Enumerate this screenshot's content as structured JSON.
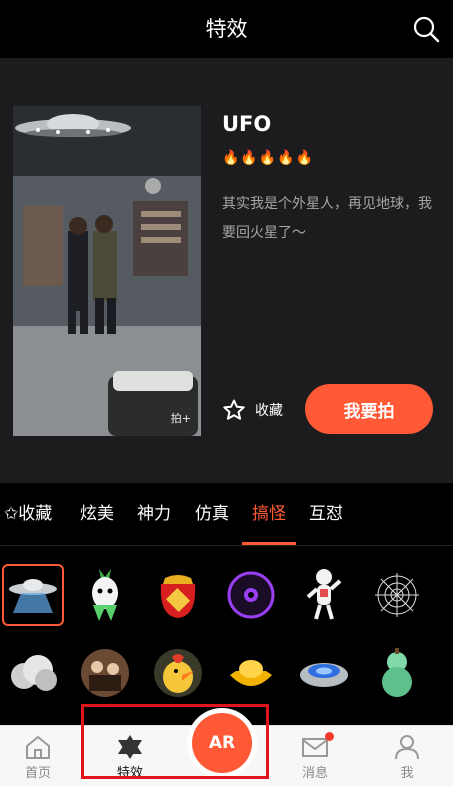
{
  "header": {
    "title": "特效",
    "search_icon": "search-icon"
  },
  "effect": {
    "name": "UFO",
    "rating_fires": "🔥🔥🔥🔥🔥",
    "description": "其实我是个外星人，再见地球，我要回火星了～",
    "favorite_label": "收藏",
    "shoot_label": "我要拍",
    "watermark": "拍+"
  },
  "tabs": [
    {
      "label": "✩收藏",
      "active": false
    },
    {
      "label": "炫美",
      "active": false
    },
    {
      "label": "神力",
      "active": false
    },
    {
      "label": "仿真",
      "active": false
    },
    {
      "label": "搞怪",
      "active": true
    },
    {
      "label": "互怼",
      "active": false
    }
  ],
  "effects_grid": [
    {
      "icon": "ufo-icon",
      "selected": true
    },
    {
      "icon": "radish-ghost-icon",
      "selected": false
    },
    {
      "icon": "red-envelope-bag-icon",
      "selected": false
    },
    {
      "icon": "purple-disc-icon",
      "selected": false
    },
    {
      "icon": "dancing-dog-icon",
      "selected": false
    },
    {
      "icon": "spider-web-icon",
      "selected": false
    },
    {
      "icon": "smoke-cloud-icon",
      "selected": false
    },
    {
      "icon": "movie-poster-icon",
      "selected": false
    },
    {
      "icon": "rubber-chicken-icon",
      "selected": false
    },
    {
      "icon": "gold-ingot-icon",
      "selected": false
    },
    {
      "icon": "gas-stove-icon",
      "selected": false
    },
    {
      "icon": "gourd-icon",
      "selected": false
    }
  ],
  "bottom_nav": {
    "home": "首页",
    "effects": "特效",
    "ar": "AR",
    "messages": "消息",
    "me": "我"
  },
  "colors": {
    "accent": "#ff5a35",
    "highlight_box": "#e0141b"
  }
}
